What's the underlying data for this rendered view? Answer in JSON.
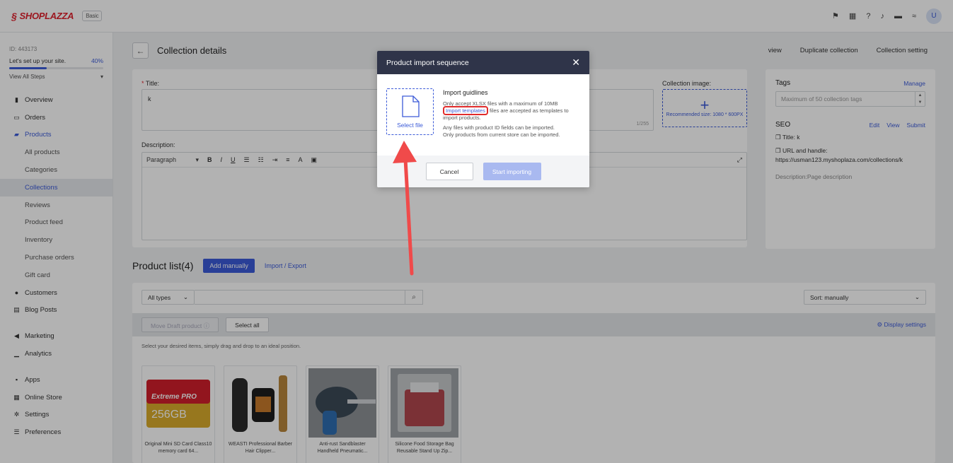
{
  "app": {
    "brand": "SHOPLAZZA",
    "plan": "Basic",
    "avatar_initial": "U"
  },
  "top_icons": [
    "flag-icon",
    "store-icon",
    "help-icon",
    "bell-icon",
    "chat-icon",
    "wifi-icon"
  ],
  "sidebar": {
    "store_id_prefix": "ID: 443173",
    "setup_label": "Let's set up your site.",
    "setup_progress": "40%",
    "setup_fraction": 0.4,
    "view_steps": "View All Steps",
    "items": [
      {
        "label": "Overview",
        "icon": "overview-icon",
        "type": "main"
      },
      {
        "label": "Orders",
        "icon": "orders-icon",
        "type": "main"
      },
      {
        "label": "Products",
        "icon": "products-icon",
        "type": "main",
        "state": "blue"
      },
      {
        "label": "All products",
        "type": "sub"
      },
      {
        "label": "Categories",
        "type": "sub"
      },
      {
        "label": "Collections",
        "type": "sub",
        "state": "active"
      },
      {
        "label": "Reviews",
        "type": "sub"
      },
      {
        "label": "Product feed",
        "type": "sub"
      },
      {
        "label": "Inventory",
        "type": "sub"
      },
      {
        "label": "Purchase orders",
        "type": "sub"
      },
      {
        "label": "Gift card",
        "type": "sub"
      },
      {
        "label": "Customers",
        "icon": "customers-icon",
        "type": "main"
      },
      {
        "label": "Blog Posts",
        "icon": "blog-icon",
        "type": "main"
      },
      {
        "label": "Marketing",
        "icon": "marketing-icon",
        "type": "main",
        "gap": true
      },
      {
        "label": "Analytics",
        "icon": "analytics-icon",
        "type": "main"
      },
      {
        "label": "Apps",
        "icon": "apps-icon",
        "type": "main",
        "gap": true
      },
      {
        "label": "Online Store",
        "icon": "online-store-icon",
        "type": "main"
      },
      {
        "label": "Settings",
        "icon": "settings-icon",
        "type": "main"
      },
      {
        "label": "Preferences",
        "icon": "preferences-icon",
        "type": "main"
      }
    ]
  },
  "page": {
    "title": "Collection details",
    "actions": [
      "view",
      "Duplicate collection",
      "Collection setting"
    ]
  },
  "form": {
    "title_label": "Title:",
    "title_value": "k",
    "title_counter": "1/255",
    "image_label": "Collection image:",
    "image_hint": "Recommended size: 1080 * 600PX",
    "description_label": "Description:",
    "toolbar_paragraph": "Paragraph"
  },
  "side": {
    "tags_title": "Tags",
    "tags_manage": "Manage",
    "tags_placeholder": "Maximum of 50 collection tags",
    "seo_title": "SEO",
    "seo_links": [
      "Edit",
      "View",
      "Submit"
    ],
    "seo_title_line": "Title: k",
    "seo_url_line": "URL and handle: https://usman123.myshoplaza.com/collections/k",
    "seo_description": "Description:Page description"
  },
  "product_list": {
    "title": "Product list(4)",
    "add_manually": "Add manually",
    "import_export": "Import / Export",
    "type_filter": "All types",
    "sort": "Sort: manually",
    "move_draft": "Move Draft product",
    "select_all": "Select all",
    "display_settings": "Display settings",
    "drag_hint": "Select your desired items, simply drag and drop to an ideal position.",
    "products": [
      {
        "name": "Original Mini SD Card Class10 memory card 64...",
        "image": "sd-card",
        "brand": "Extreme PRO",
        "capacity": "256GB"
      },
      {
        "name": "WEASTI Professional Barber Hair Clipper...",
        "image": "clipper"
      },
      {
        "name": "Anti-rust Sandblaster Handheld Pneumatic...",
        "image": "sandblaster"
      },
      {
        "name": "Silicone Food Storage Bag Reusable Stand Up Zip...",
        "image": "food-bag"
      }
    ]
  },
  "modal": {
    "title": "Product import sequence",
    "select_file": "Select file",
    "guide_title": "Import guidlines",
    "line1": "Only accept XLSX files with a maximum of 10MB",
    "template_link": "Import templates",
    "line2_rest": " files are accepted as templates to import products.",
    "line3": "Any files with product ID fields can be imported.",
    "line4": "Only products from current store can be imported.",
    "cancel": "Cancel",
    "start": "Start importing"
  },
  "colors": {
    "accent": "#3c5bd8",
    "brand_red": "#e0232f",
    "modal_header": "#2f3449",
    "annotation_red": "#f04a4a"
  }
}
